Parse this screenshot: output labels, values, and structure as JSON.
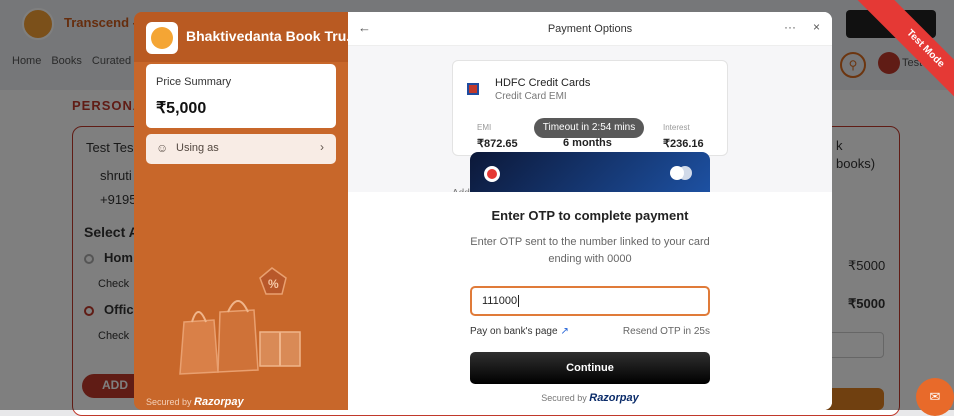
{
  "background": {
    "brand": "Transcend -",
    "nav": [
      "Home",
      "Books",
      "Curated"
    ],
    "user": "Test",
    "section_title": "PERSONA",
    "name": "Test Tes",
    "email": "shruti",
    "phone": "+9195",
    "select_address": "Select A",
    "address_home": "Hom",
    "address_home_check": "Check",
    "address_office": "Offic",
    "address_office_check": "Check",
    "add_btn": "ADD",
    "right_k": "k",
    "right_books": "books)",
    "right_price1": "₹5000",
    "right_price2": "₹5000",
    "right_field": "/)"
  },
  "test_mode_label": "Test Mode",
  "merchant": {
    "name": "Bhaktivedanta Book Tru..."
  },
  "price_summary": {
    "label": "Price Summary",
    "amount": "₹5,000"
  },
  "using_as": {
    "label": "Using as"
  },
  "secured_left": {
    "prefix": "Secured by",
    "brand": "Razorpay"
  },
  "payment_options": {
    "title": "Payment Options",
    "more_label": "···",
    "close_label": "×",
    "back_label": "←",
    "emi_card": {
      "bank": "HDFC Credit Cards",
      "sub": "Credit Card EMI",
      "emi_label": "EMI",
      "emi_value": "₹872.65",
      "tenure_value": "6 months",
      "interest_label": "Interest",
      "interest_value": "₹236.16"
    },
    "timeout_text": "Timeout in 2:54 mins",
    "add_text": "Add"
  },
  "otp": {
    "title": "Enter OTP to complete payment",
    "description": "Enter OTP sent to the number linked to your card ending with 0000",
    "value": "111000",
    "bank_page_link": "Pay on bank's page",
    "resend_text": "Resend OTP in 25s",
    "continue_label": "Continue",
    "secured_prefix": "Secured by",
    "secured_brand": "Razorpay"
  },
  "colors": {
    "brand_orange": "#c8672a",
    "accent": "#e07b39",
    "test_mode": "#e53935"
  },
  "icons": {
    "using_as": "user-icon",
    "bank_page": "external-link-icon",
    "chat": "chat-icon"
  }
}
